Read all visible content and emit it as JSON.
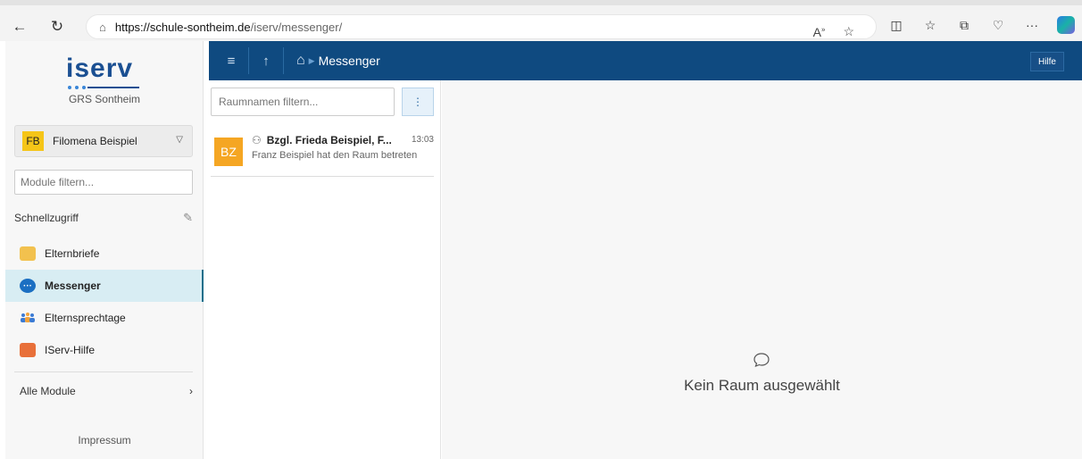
{
  "browser": {
    "url_host": "https://schule-sontheim.de",
    "url_path": "/iserv/messenger/"
  },
  "sidebar": {
    "logo": "iserv",
    "school": "GRS Sontheim",
    "user": {
      "initials": "FB",
      "name": "Filomena Beispiel"
    },
    "module_filter_placeholder": "Module filtern...",
    "quick_access_label": "Schnellzugriff",
    "items": [
      {
        "label": "Elternbriefe",
        "icon": "letter-icon"
      },
      {
        "label": "Messenger",
        "icon": "chat-bubble-icon",
        "active": true
      },
      {
        "label": "Elternsprechtage",
        "icon": "people-icon"
      },
      {
        "label": "IServ-Hilfe",
        "icon": "help-book-icon"
      }
    ],
    "all_modules_label": "Alle Module",
    "impressum_label": "Impressum"
  },
  "app_bar": {
    "title": "Messenger",
    "help_label": "Hilfe"
  },
  "rooms": {
    "filter_placeholder": "Raumnamen filtern...",
    "items": [
      {
        "initials": "BZ",
        "title": "Bzgl. Frieda Beispiel, F...",
        "time": "13:03",
        "last_message": "Franz Beispiel hat den Raum betreten"
      }
    ]
  },
  "main": {
    "empty_text": "Kein Raum ausgewählt"
  }
}
